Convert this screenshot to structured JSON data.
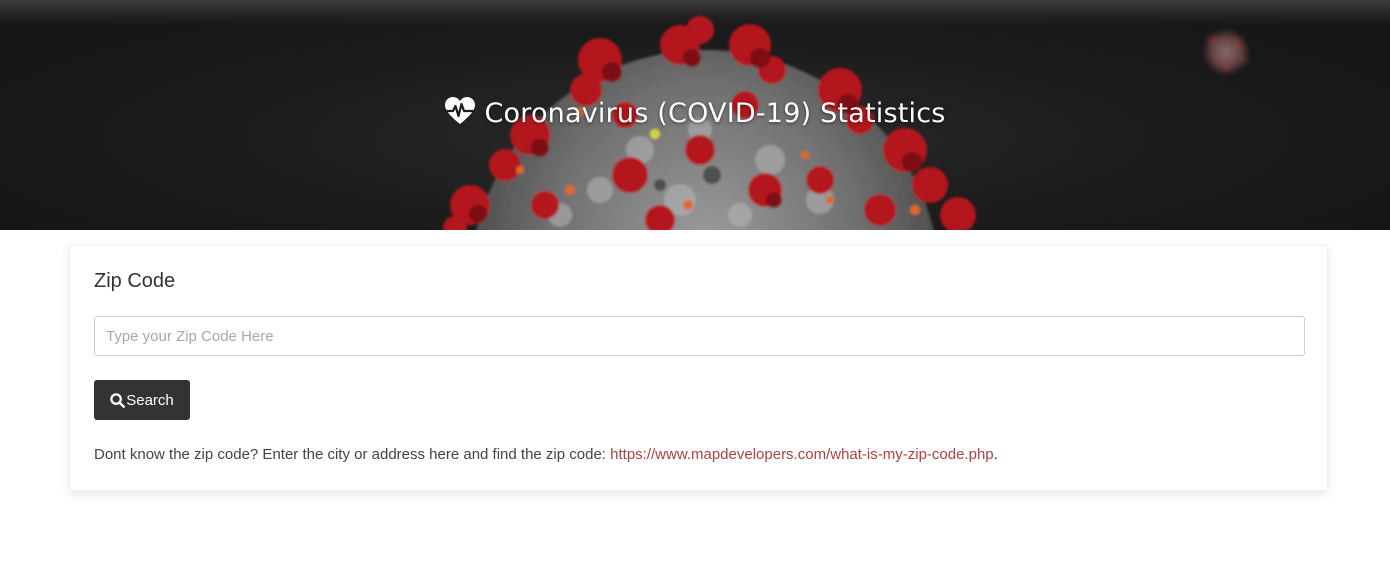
{
  "hero": {
    "title": "Coronavirus (COVID-19) Statistics",
    "icon": "heartbeat-icon"
  },
  "zip_card": {
    "title": "Zip Code",
    "input": {
      "value": "",
      "placeholder": "Type your Zip Code Here"
    },
    "search_button": {
      "label": "Search",
      "icon": "search-icon"
    },
    "help": {
      "text": "Dont know the zip code? Enter the city or address here and find the zip code: ",
      "link_text": "https://www.mapdevelopers.com/what-is-my-zip-code.php",
      "suffix": "."
    }
  },
  "colors": {
    "hero_background": "#1a1a1a",
    "button_background": "#333333",
    "link": "#a94442"
  }
}
